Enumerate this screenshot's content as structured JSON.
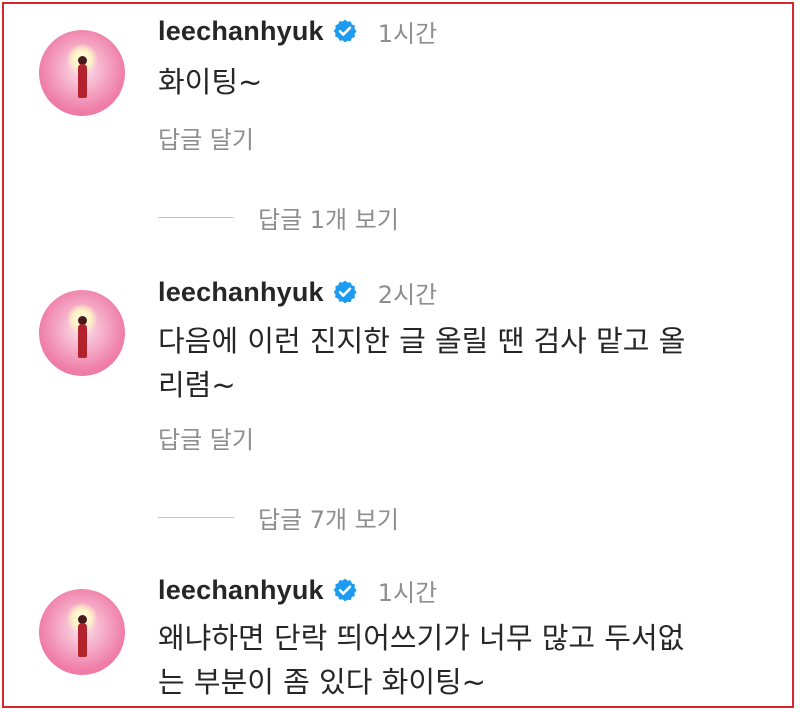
{
  "comments": [
    {
      "username": "leechanhyuk",
      "verified": true,
      "time": "1시간",
      "text": "화이팅~",
      "reply_label": "답글 달기"
    },
    {
      "username": "leechanhyuk",
      "verified": true,
      "time": "2시간",
      "text": "다음에 이런 진지한 글 올릴 땐 검사 맡고 올\n리렴~",
      "reply_label": "답글 달기"
    },
    {
      "username": "leechanhyuk",
      "verified": true,
      "time": "1시간",
      "text": "왜냐하면 단락 띄어쓰기가 너무 많고 두서없\n는 부분이 좀 있다 화이팅~"
    }
  ],
  "view_replies": [
    {
      "label": "답글 1개 보기"
    },
    {
      "label": "답글 7개 보기"
    }
  ],
  "colors": {
    "verified_badge": "#1d9bf0",
    "frame_border": "#d7262e",
    "secondary_text": "#8e8e8e",
    "primary_text": "#262626"
  },
  "icons": {
    "verified": "verified-badge-icon",
    "avatar": "profile-avatar"
  }
}
